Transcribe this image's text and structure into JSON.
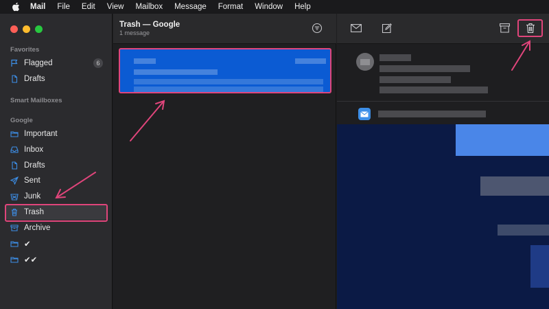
{
  "menubar": {
    "apple_icon": "apple-icon",
    "items": [
      "Mail",
      "File",
      "Edit",
      "View",
      "Mailbox",
      "Message",
      "Format",
      "Window",
      "Help"
    ]
  },
  "sidebar": {
    "favorites_label": "Favorites",
    "flagged": {
      "label": "Flagged",
      "count": "6"
    },
    "drafts_fav": {
      "label": "Drafts"
    },
    "smart_label": "Smart Mailboxes",
    "google_label": "Google",
    "items": [
      {
        "label": "Important",
        "icon": "folder-icon"
      },
      {
        "label": "Inbox",
        "icon": "inbox-icon"
      },
      {
        "label": "Drafts",
        "icon": "document-icon"
      },
      {
        "label": "Sent",
        "icon": "paperplane-icon"
      },
      {
        "label": "Junk",
        "icon": "junk-icon"
      },
      {
        "label": "Trash",
        "icon": "trash-icon"
      },
      {
        "label": "Archive",
        "icon": "archive-icon"
      },
      {
        "label": "✔",
        "icon": "folder-icon"
      },
      {
        "label": "✔✔",
        "icon": "folder-icon"
      }
    ]
  },
  "list": {
    "title": "Trash — Google",
    "subtitle": "1 message"
  },
  "colors": {
    "accent": "#0b5bd3",
    "annotation": "#e0457b",
    "folder_icon": "#3d8fe8"
  }
}
